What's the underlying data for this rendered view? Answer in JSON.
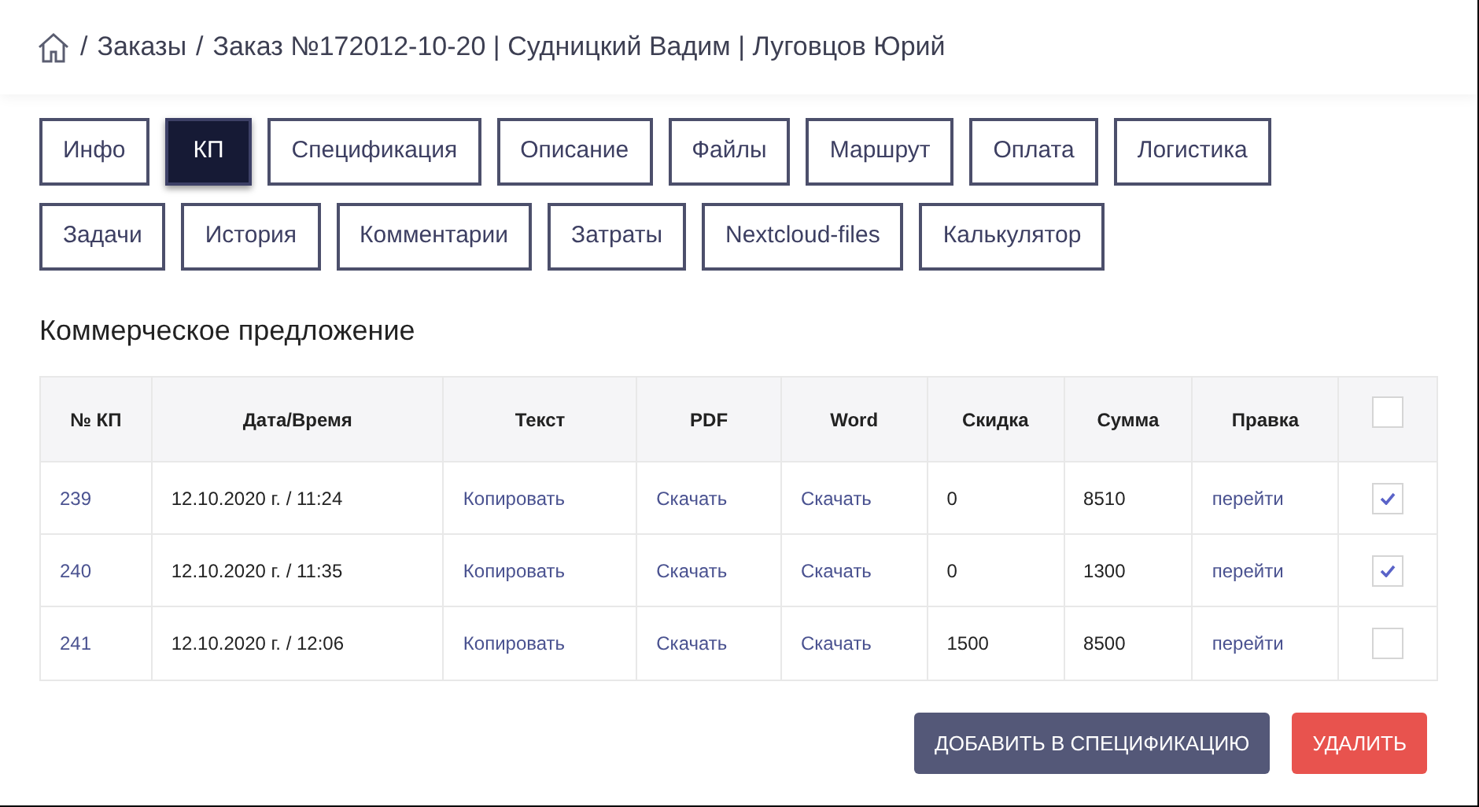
{
  "breadcrumb": {
    "separator": "/",
    "items": [
      "Заказы",
      "Заказ №172012-10-20 | Судницкий Вадим | Луговцов Юрий"
    ]
  },
  "tabs": [
    {
      "label": "Инфо",
      "selected": false
    },
    {
      "label": "КП",
      "selected": true
    },
    {
      "label": "Спецификация",
      "selected": false
    },
    {
      "label": "Описание",
      "selected": false
    },
    {
      "label": "Файлы",
      "selected": false
    },
    {
      "label": "Маршрут",
      "selected": false
    },
    {
      "label": "Оплата",
      "selected": false
    },
    {
      "label": "Логистика",
      "selected": false
    },
    {
      "label": "Задачи",
      "selected": false
    },
    {
      "label": "История",
      "selected": false
    },
    {
      "label": "Комментарии",
      "selected": false
    },
    {
      "label": "Затраты",
      "selected": false
    },
    {
      "label": "Nextcloud-files",
      "selected": false
    },
    {
      "label": "Калькулятор",
      "selected": false
    }
  ],
  "section_title": "Коммерческое предложение",
  "table": {
    "columns": [
      "№ КП",
      "Дата/Время",
      "Текст",
      "PDF",
      "Word",
      "Скидка",
      "Сумма",
      "Правка"
    ],
    "select_all": {
      "checked": false
    },
    "rows": [
      {
        "number": "239",
        "datetime": "12.10.2020 г. / 11:24",
        "text": "Копировать",
        "pdf": "Скачать",
        "word": "Скачать",
        "discount": "0",
        "sum": "8510",
        "edit": "перейти",
        "checked": true
      },
      {
        "number": "240",
        "datetime": "12.10.2020 г. / 11:35",
        "text": "Копировать",
        "pdf": "Скачать",
        "word": "Скачать",
        "discount": "0",
        "sum": "1300",
        "edit": "перейти",
        "checked": true
      },
      {
        "number": "241",
        "datetime": "12.10.2020 г. / 12:06",
        "text": "Копировать",
        "pdf": "Скачать",
        "word": "Скачать",
        "discount": "1500",
        "sum": "8500",
        "edit": "перейти",
        "checked": false
      }
    ]
  },
  "buttons": [
    {
      "label": "ДОБАВИТЬ В СПЕЦИФИКАЦИЮ",
      "kind": "primary"
    },
    {
      "label": "УДАЛИТЬ",
      "kind": "danger"
    }
  ]
}
